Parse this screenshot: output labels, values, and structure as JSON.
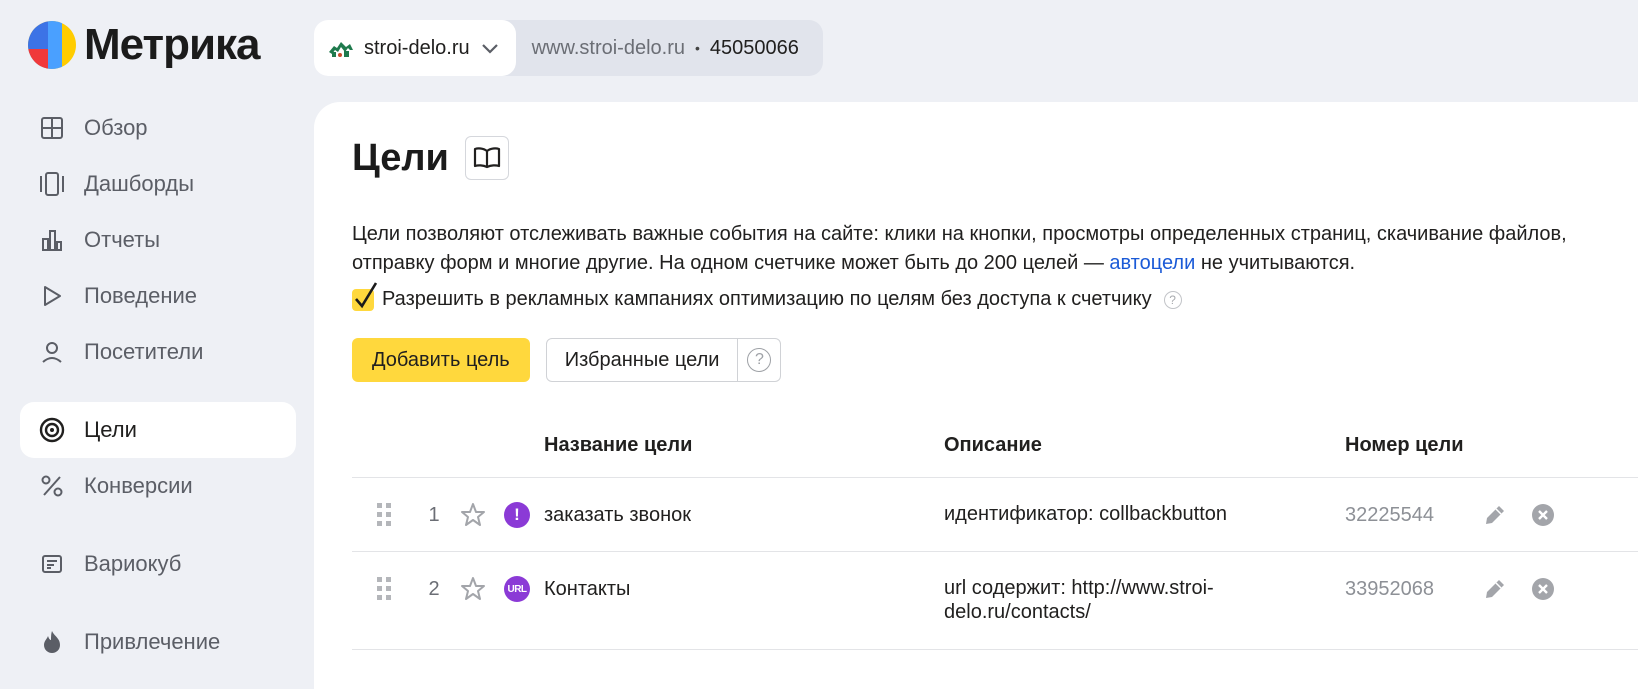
{
  "header": {
    "logo_text": "Метрика",
    "counter": {
      "site_name": "stroi-delo.ru",
      "url": "www.stroi-delo.ru",
      "separator": "•",
      "id": "45050066"
    }
  },
  "sidebar": {
    "items": [
      {
        "label": "Обзор",
        "icon": "grid-icon"
      },
      {
        "label": "Дашборды",
        "icon": "dashboards-icon"
      },
      {
        "label": "Отчеты",
        "icon": "bar-chart-icon"
      },
      {
        "label": "Поведение",
        "icon": "play-icon"
      },
      {
        "label": "Посетители",
        "icon": "user-icon"
      },
      {
        "label": "Цели",
        "icon": "target-icon",
        "active": true
      },
      {
        "label": "Конверсии",
        "icon": "percent-icon"
      },
      {
        "label": "Вариокуб",
        "icon": "variocube-icon"
      },
      {
        "label": "Привлечение",
        "icon": "fire-icon"
      }
    ]
  },
  "main": {
    "title": "Цели",
    "description_part1": "Цели позволяют отслеживать важные события на сайте: клики на кнопки, просмотры определенных страниц, скачивание файлов, отправку форм и многие другие. На одном счетчике может быть до 200 целей — ",
    "description_link": "автоцели",
    "description_part2": " не учитываются.",
    "checkbox_label": "Разрешить в рекламных кампаниях оптимизацию по целям без доступа к счетчику",
    "checkbox_checked": true,
    "help_glyph": "?",
    "add_button": "Добавить цель",
    "favorites_button": "Избранные цели",
    "table": {
      "headers": {
        "name": "Название цели",
        "description": "Описание",
        "number": "Номер цели"
      },
      "rows": [
        {
          "index": "1",
          "type_glyph": "!",
          "type": "action",
          "name": "заказать звонок",
          "description": "идентификатор: collbackbutton",
          "number": "32225544"
        },
        {
          "index": "2",
          "type_glyph": "URL",
          "type": "url",
          "name": "Контакты",
          "description": "url содержит: http://www.stroi-delo.ru/contacts/",
          "number": "33952068"
        }
      ]
    }
  },
  "colors": {
    "accent_yellow": "#ffd83d",
    "link_blue": "#1a5ad7",
    "goal_type_purple": "#8b3ad6",
    "background": "#eef0f5"
  }
}
